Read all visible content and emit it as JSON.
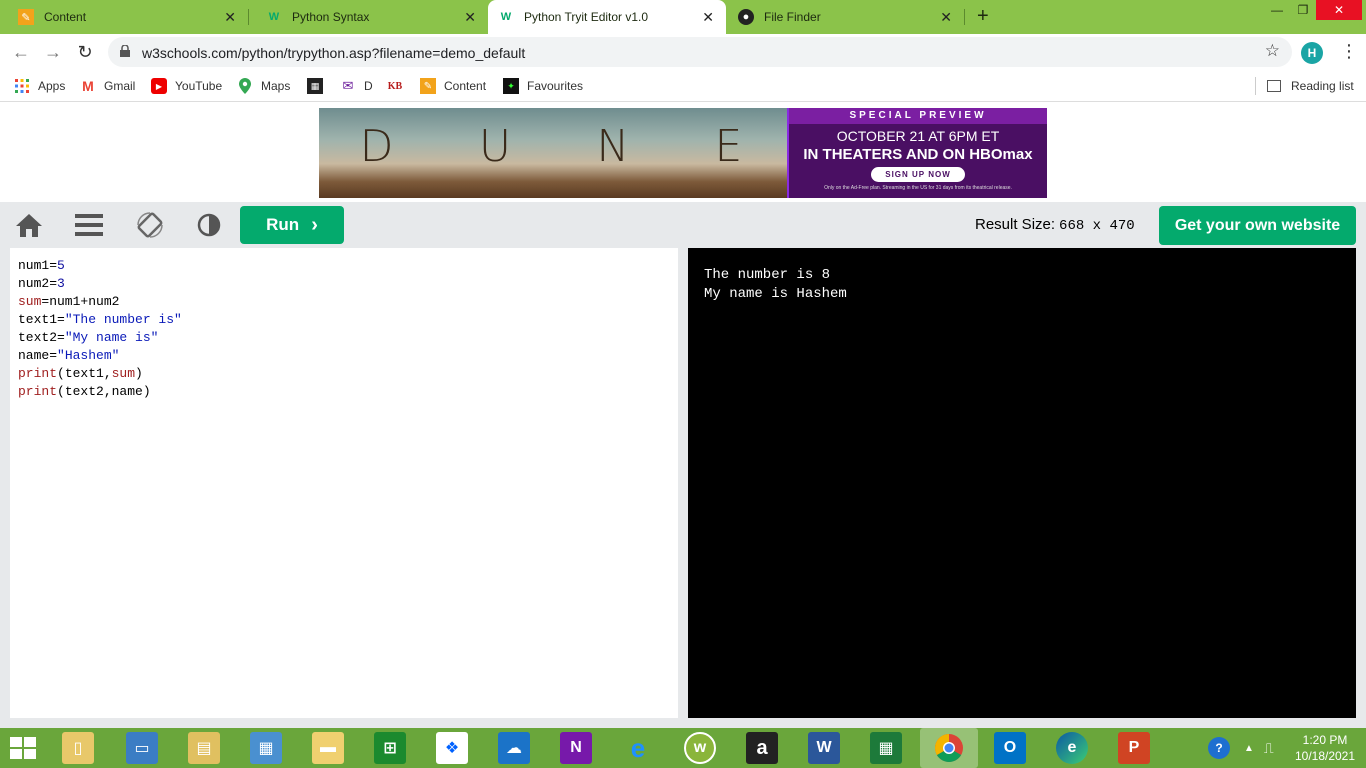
{
  "tabs": [
    {
      "title": "Content",
      "favicon": "pencil-icon",
      "active": false
    },
    {
      "title": "Python Syntax",
      "favicon": "w3schools-icon",
      "active": false
    },
    {
      "title": "Python Tryit Editor v1.0",
      "favicon": "w3schools-icon",
      "active": true
    },
    {
      "title": "File Finder",
      "favicon": "github-icon",
      "active": false
    }
  ],
  "address": {
    "url": "w3schools.com/python/trypython.asp?filename=demo_default",
    "profile_initial": "H"
  },
  "bookmarks": [
    {
      "label": "Apps",
      "icon": "apps-grid-icon"
    },
    {
      "label": "Gmail",
      "icon": "gmail-icon"
    },
    {
      "label": "YouTube",
      "icon": "youtube-icon"
    },
    {
      "label": "Maps",
      "icon": "maps-icon"
    },
    {
      "label": "",
      "icon": "film-icon"
    },
    {
      "label": "D",
      "icon": "mail-icon"
    },
    {
      "label": "",
      "icon": "kb-icon"
    },
    {
      "label": "Content",
      "icon": "pencil-icon"
    },
    {
      "label": "Favourites",
      "icon": "bookmark-icon"
    }
  ],
  "reading_list": "Reading list",
  "ad": {
    "title_letters": [
      "D",
      "U",
      "N",
      "E"
    ],
    "preview": "SPECIAL PREVIEW",
    "date_line": "OCTOBER 21 AT 6PM ET",
    "theaters_line": "IN THEATERS AND ON HBOmax",
    "cta": "SIGN UP NOW",
    "fine_print": "Only on the Ad-Free plan. Streaming in the US for 31 days from its theatrical release."
  },
  "editor": {
    "run_label": "Run",
    "result_size_label": "Result Size:",
    "result_size_value": "668 x 470",
    "get_website_label": "Get your own website"
  },
  "code": [
    "num1=5",
    "num2=3",
    "sum=num1+num2",
    "text1=\"The number is\"",
    "text2=\"My name is\"",
    "name=\"Hashem\"",
    "print(text1,sum)",
    "print(text2,name)"
  ],
  "output": [
    "The number is 8",
    "My name is Hashem"
  ],
  "taskbar_apps": [
    "file-explorer-icon",
    "computer-icon",
    "folder-icon",
    "control-panel-icon",
    "documents-folder-icon",
    "store-icon",
    "dropbox-icon",
    "onedrive-icon",
    "onenote-icon",
    "internet-explorer-icon",
    "webex-icon",
    "amazon-icon",
    "word-icon",
    "calculator-icon",
    "chrome-icon",
    "outlook-icon",
    "edge-icon",
    "powerpoint-icon"
  ],
  "clock": {
    "time": "1:20 PM",
    "date": "10/18/2021"
  },
  "colors": {
    "tabstrip": "#8bc34a",
    "run": "#04aa6d",
    "taskbar": "#6aa63b"
  }
}
